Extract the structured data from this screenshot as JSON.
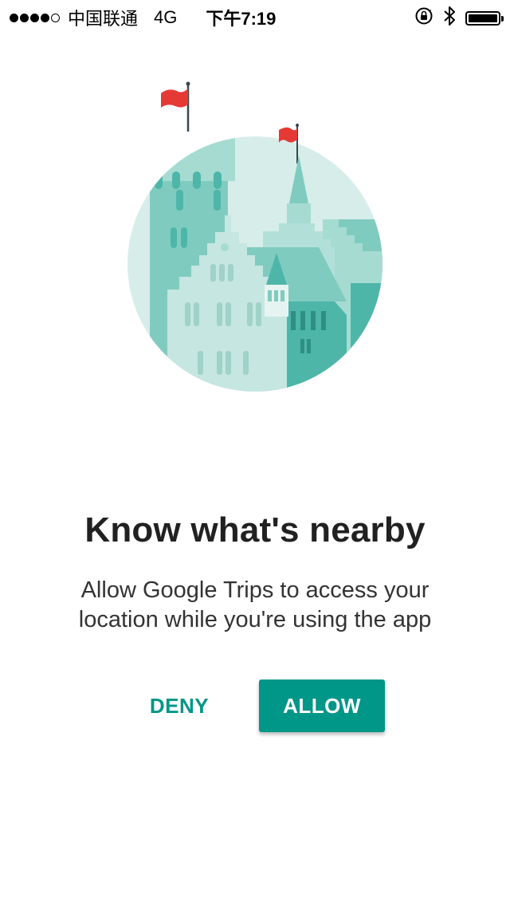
{
  "status_bar": {
    "signal_filled": 4,
    "signal_total": 5,
    "carrier": "中国联通",
    "network": "4G",
    "time": "下午7:19",
    "icons": [
      "orientation-lock-icon",
      "bluetooth-icon",
      "battery-icon"
    ],
    "battery_level": 1.0
  },
  "illustration": {
    "icon": "castle-illustration",
    "colors": {
      "circle_bg": "#d7ede9",
      "tower_main": "#80cbc0",
      "tower_dark": "#4db6a8",
      "building_light": "#c6e6e1",
      "flag": "#e53935"
    }
  },
  "content": {
    "title": "Know what's nearby",
    "subtitle_line1": "Allow Google Trips to access your",
    "subtitle_line2": "location while you're using the app"
  },
  "actions": {
    "deny_label": "DENY",
    "allow_label": "ALLOW",
    "accent_color": "#009688"
  }
}
